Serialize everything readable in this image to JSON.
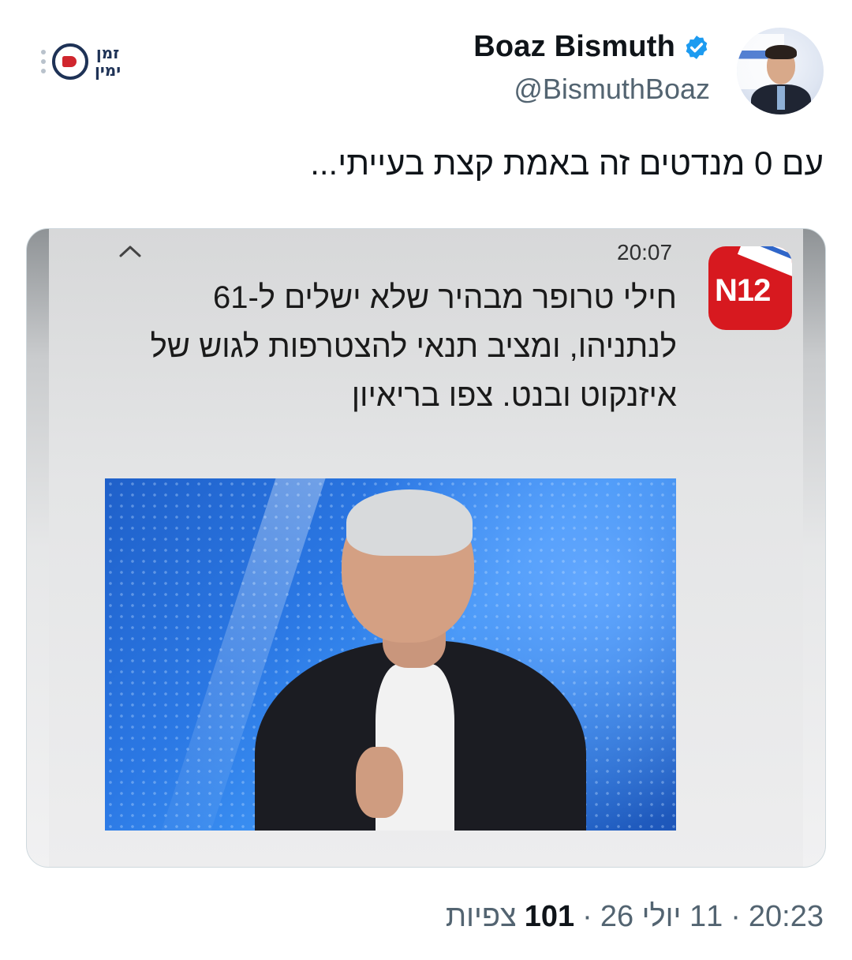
{
  "author": {
    "display_name": "Boaz Bismuth",
    "handle": "@BismuthBoaz",
    "verified_icon": "verified-badge-icon",
    "verified_color": "#1d9bf0"
  },
  "watermark": {
    "line1": "זמן",
    "line2": "ימין"
  },
  "tweet": {
    "text": "עם 0 מנדטים זה באמת קצת בעייתי..."
  },
  "embedded": {
    "time": "20:07",
    "app_icon_label": "N12",
    "headline": "חילי טרופר מבהיר שלא ישלים ל-61 לנתניהו, ומציב תנאי להצטרפות לגוש של איזנקוט ובנט. צפו בריאיון"
  },
  "meta": {
    "time": "20:23",
    "sep1": "·",
    "date": "11 יולי 26",
    "sep2": "·",
    "views_count": "101",
    "views_label": "צפיות"
  }
}
